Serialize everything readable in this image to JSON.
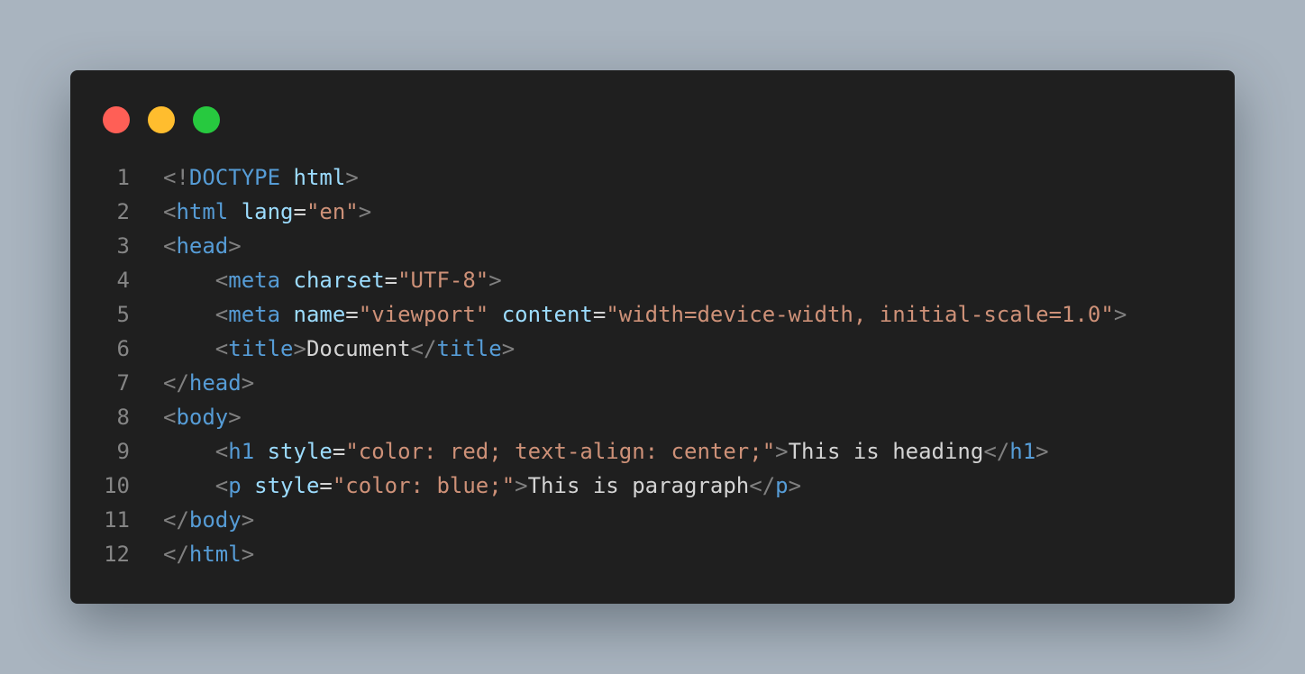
{
  "window": {
    "controls": [
      {
        "name": "close",
        "color": "#ff5f56"
      },
      {
        "name": "minimize",
        "color": "#ffbd2e"
      },
      {
        "name": "maximize",
        "color": "#27c93f"
      }
    ]
  },
  "theme": {
    "background": "#1f1f1f",
    "page_background": "#a9b4bf",
    "line_number": "#858585",
    "punct": "#808080",
    "tag": "#569cd6",
    "attr": "#9cdcfe",
    "string": "#ce9178",
    "text": "#d4d4d4"
  },
  "code": {
    "lines": [
      {
        "number": "1",
        "tokens": [
          {
            "t": "punct",
            "v": "<!"
          },
          {
            "t": "tag",
            "v": "DOCTYPE"
          },
          {
            "t": "text",
            "v": " "
          },
          {
            "t": "attr",
            "v": "html"
          },
          {
            "t": "punct",
            "v": ">"
          }
        ]
      },
      {
        "number": "2",
        "tokens": [
          {
            "t": "punct",
            "v": "<"
          },
          {
            "t": "tag",
            "v": "html"
          },
          {
            "t": "text",
            "v": " "
          },
          {
            "t": "attr",
            "v": "lang"
          },
          {
            "t": "text",
            "v": "="
          },
          {
            "t": "str",
            "v": "\"en\""
          },
          {
            "t": "punct",
            "v": ">"
          }
        ]
      },
      {
        "number": "3",
        "tokens": [
          {
            "t": "punct",
            "v": "<"
          },
          {
            "t": "tag",
            "v": "head"
          },
          {
            "t": "punct",
            "v": ">"
          }
        ]
      },
      {
        "number": "4",
        "tokens": [
          {
            "t": "text",
            "v": "    "
          },
          {
            "t": "punct",
            "v": "<"
          },
          {
            "t": "tag",
            "v": "meta"
          },
          {
            "t": "text",
            "v": " "
          },
          {
            "t": "attr",
            "v": "charset"
          },
          {
            "t": "text",
            "v": "="
          },
          {
            "t": "str",
            "v": "\"UTF-8\""
          },
          {
            "t": "punct",
            "v": ">"
          }
        ]
      },
      {
        "number": "5",
        "tokens": [
          {
            "t": "text",
            "v": "    "
          },
          {
            "t": "punct",
            "v": "<"
          },
          {
            "t": "tag",
            "v": "meta"
          },
          {
            "t": "text",
            "v": " "
          },
          {
            "t": "attr",
            "v": "name"
          },
          {
            "t": "text",
            "v": "="
          },
          {
            "t": "str",
            "v": "\"viewport\""
          },
          {
            "t": "text",
            "v": " "
          },
          {
            "t": "attr",
            "v": "content"
          },
          {
            "t": "text",
            "v": "="
          },
          {
            "t": "str",
            "v": "\"width=device-width, initial-scale=1.0\""
          },
          {
            "t": "punct",
            "v": ">"
          }
        ]
      },
      {
        "number": "6",
        "tokens": [
          {
            "t": "text",
            "v": "    "
          },
          {
            "t": "punct",
            "v": "<"
          },
          {
            "t": "tag",
            "v": "title"
          },
          {
            "t": "punct",
            "v": ">"
          },
          {
            "t": "text",
            "v": "Document"
          },
          {
            "t": "punct",
            "v": "</"
          },
          {
            "t": "tag",
            "v": "title"
          },
          {
            "t": "punct",
            "v": ">"
          }
        ]
      },
      {
        "number": "7",
        "tokens": [
          {
            "t": "punct",
            "v": "</"
          },
          {
            "t": "tag",
            "v": "head"
          },
          {
            "t": "punct",
            "v": ">"
          }
        ]
      },
      {
        "number": "8",
        "tokens": [
          {
            "t": "punct",
            "v": "<"
          },
          {
            "t": "tag",
            "v": "body"
          },
          {
            "t": "punct",
            "v": ">"
          }
        ]
      },
      {
        "number": "9",
        "tokens": [
          {
            "t": "text",
            "v": "    "
          },
          {
            "t": "punct",
            "v": "<"
          },
          {
            "t": "tag",
            "v": "h1"
          },
          {
            "t": "text",
            "v": " "
          },
          {
            "t": "attr",
            "v": "style"
          },
          {
            "t": "text",
            "v": "="
          },
          {
            "t": "str",
            "v": "\"color: red; text-align: center;\""
          },
          {
            "t": "punct",
            "v": ">"
          },
          {
            "t": "text",
            "v": "This is heading"
          },
          {
            "t": "punct",
            "v": "</"
          },
          {
            "t": "tag",
            "v": "h1"
          },
          {
            "t": "punct",
            "v": ">"
          }
        ]
      },
      {
        "number": "10",
        "tokens": [
          {
            "t": "text",
            "v": "    "
          },
          {
            "t": "punct",
            "v": "<"
          },
          {
            "t": "tag",
            "v": "p"
          },
          {
            "t": "text",
            "v": " "
          },
          {
            "t": "attr",
            "v": "style"
          },
          {
            "t": "text",
            "v": "="
          },
          {
            "t": "str",
            "v": "\"color: blue;\""
          },
          {
            "t": "punct",
            "v": ">"
          },
          {
            "t": "text",
            "v": "This is paragraph"
          },
          {
            "t": "punct",
            "v": "</"
          },
          {
            "t": "tag",
            "v": "p"
          },
          {
            "t": "punct",
            "v": ">"
          }
        ]
      },
      {
        "number": "11",
        "tokens": [
          {
            "t": "punct",
            "v": "</"
          },
          {
            "t": "tag",
            "v": "body"
          },
          {
            "t": "punct",
            "v": ">"
          }
        ]
      },
      {
        "number": "12",
        "tokens": [
          {
            "t": "punct",
            "v": "</"
          },
          {
            "t": "tag",
            "v": "html"
          },
          {
            "t": "punct",
            "v": ">"
          }
        ]
      }
    ]
  }
}
